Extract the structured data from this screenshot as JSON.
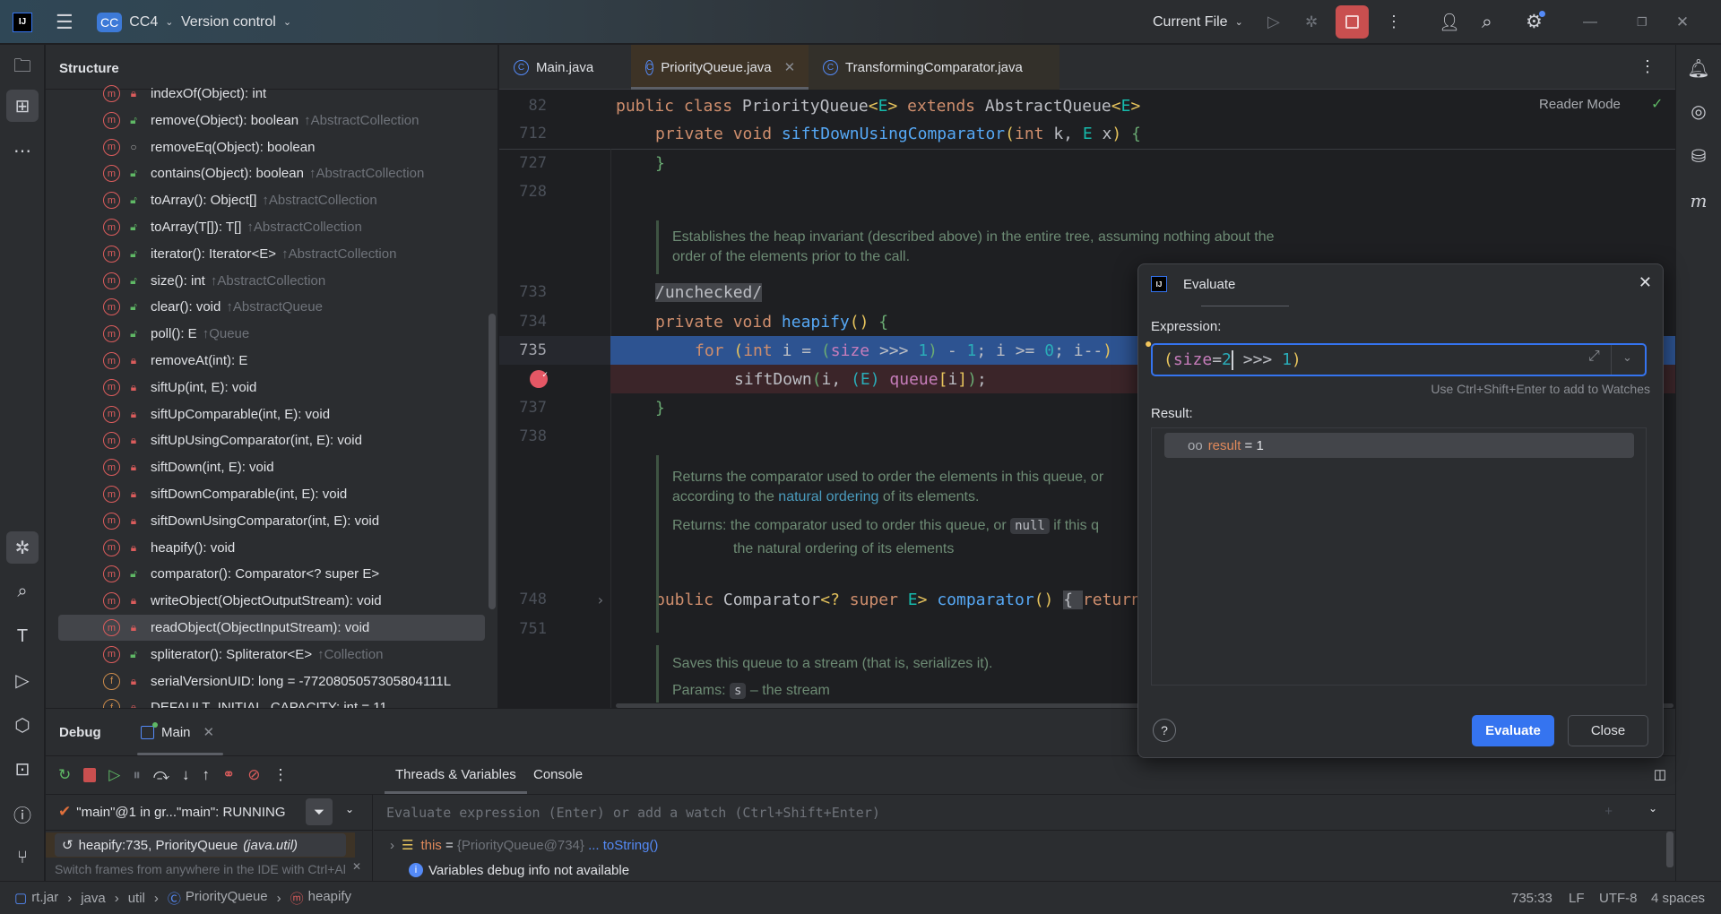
{
  "titlebar": {
    "project_badge": "CC",
    "project": "CC4",
    "vcs": "Version control",
    "run_config": "Current File"
  },
  "structure": {
    "title": "Structure",
    "items": [
      {
        "icon": "m",
        "vis": "priv",
        "label": "indexOf(Object): int",
        "inherited": ""
      },
      {
        "icon": "m",
        "vis": "pub",
        "label": "remove(Object): boolean",
        "inherited": "↑AbstractCollection"
      },
      {
        "icon": "m",
        "vis": "pkg",
        "label": "removeEq(Object): boolean",
        "inherited": ""
      },
      {
        "icon": "m",
        "vis": "pub",
        "label": "contains(Object): boolean",
        "inherited": "↑AbstractCollection"
      },
      {
        "icon": "m",
        "vis": "pub",
        "label": "toArray(): Object[]",
        "inherited": "↑AbstractCollection"
      },
      {
        "icon": "m",
        "vis": "pub",
        "label": "toArray(T[]): T[]",
        "inherited": "↑AbstractCollection"
      },
      {
        "icon": "m",
        "vis": "pub",
        "label": "iterator(): Iterator<E>",
        "inherited": "↑AbstractCollection"
      },
      {
        "icon": "m",
        "vis": "pub",
        "label": "size(): int",
        "inherited": "↑AbstractCollection"
      },
      {
        "icon": "m",
        "vis": "pub",
        "label": "clear(): void",
        "inherited": "↑AbstractQueue"
      },
      {
        "icon": "m",
        "vis": "pub",
        "label": "poll(): E",
        "inherited": "↑Queue"
      },
      {
        "icon": "m",
        "vis": "priv",
        "label": "removeAt(int): E",
        "inherited": ""
      },
      {
        "icon": "m",
        "vis": "priv",
        "label": "siftUp(int, E): void",
        "inherited": ""
      },
      {
        "icon": "m",
        "vis": "priv",
        "label": "siftUpComparable(int, E): void",
        "inherited": ""
      },
      {
        "icon": "m",
        "vis": "priv",
        "label": "siftUpUsingComparator(int, E): void",
        "inherited": ""
      },
      {
        "icon": "m",
        "vis": "priv",
        "label": "siftDown(int, E): void",
        "inherited": ""
      },
      {
        "icon": "m",
        "vis": "priv",
        "label": "siftDownComparable(int, E): void",
        "inherited": ""
      },
      {
        "icon": "m",
        "vis": "priv",
        "label": "siftDownUsingComparator(int, E): void",
        "inherited": ""
      },
      {
        "icon": "m",
        "vis": "priv",
        "label": "heapify(): void",
        "inherited": ""
      },
      {
        "icon": "m",
        "vis": "pub",
        "label": "comparator(): Comparator<? super E>",
        "inherited": ""
      },
      {
        "icon": "m",
        "vis": "priv",
        "label": "writeObject(ObjectOutputStream): void",
        "inherited": ""
      },
      {
        "icon": "m",
        "vis": "priv",
        "label": "readObject(ObjectInputStream): void",
        "inherited": "",
        "selected": true
      },
      {
        "icon": "m",
        "vis": "pub",
        "label": "spliterator(): Spliterator<E>",
        "inherited": "↑Collection"
      },
      {
        "icon": "f",
        "vis": "priv",
        "label": "serialVersionUID: long = -7720805057305804111L",
        "inherited": ""
      },
      {
        "icon": "f",
        "vis": "priv",
        "label": "DEFAULT_INITIAL_CAPACITY: int = 11",
        "inherited": ""
      }
    ]
  },
  "editor": {
    "tabs": [
      {
        "label": "Main.java"
      },
      {
        "label": "PriorityQueue.java",
        "active": true
      },
      {
        "label": "TransformingComparator.java"
      }
    ],
    "reader_mode": "Reader Mode",
    "lines": [
      {
        "n": "82",
        "indent": 0,
        "tokens": [
          [
            "public class ",
            "kw"
          ],
          [
            "PriorityQueue",
            "pl"
          ],
          [
            "<",
            "br"
          ],
          [
            "E",
            "tp"
          ],
          [
            "> ",
            "br"
          ],
          [
            "extends ",
            "kw"
          ],
          [
            "AbstractQueue",
            "pl"
          ],
          [
            "<",
            "br"
          ],
          [
            "E",
            "tp"
          ],
          [
            ">",
            "br"
          ]
        ]
      },
      {
        "n": "712",
        "indent": 1,
        "tokens": [
          [
            "private void ",
            "kw"
          ],
          [
            "siftDownUsingComparator",
            "fn"
          ],
          [
            "(",
            "br"
          ],
          [
            "int ",
            "kw"
          ],
          [
            "k, ",
            "pl"
          ],
          [
            "E ",
            "tp"
          ],
          [
            "x",
            "pl"
          ],
          [
            ") ",
            "br"
          ],
          [
            "{",
            "gb"
          ]
        ]
      },
      {
        "n": "727",
        "indent": 1,
        "tokens": [
          [
            "}",
            "gb"
          ]
        ]
      },
      {
        "n": "728",
        "indent": 0,
        "tokens": []
      },
      {
        "n": "733",
        "indent": 1,
        "tokens": [
          [
            "/unchecked/",
            "hl"
          ]
        ]
      },
      {
        "n": "734",
        "indent": 1,
        "tokens": [
          [
            "private void ",
            "kw"
          ],
          [
            "heapify",
            "fn"
          ],
          [
            "() ",
            "br"
          ],
          [
            "{",
            "gb"
          ]
        ]
      },
      {
        "n": "735",
        "indent": 2,
        "current": true,
        "tokens": [
          [
            "for ",
            "kw"
          ],
          [
            "(",
            "br"
          ],
          [
            "int ",
            "kw"
          ],
          [
            "i = ",
            "pl"
          ],
          [
            "(",
            "gb"
          ],
          [
            "size",
            "fld"
          ],
          [
            " >>> ",
            "pl"
          ],
          [
            "1",
            "num"
          ],
          [
            ")",
            "gb"
          ],
          [
            " - ",
            "pl"
          ],
          [
            "1",
            "num"
          ],
          [
            "; i >= ",
            "pl"
          ],
          [
            "0",
            "num"
          ],
          [
            "; i--",
            "pl"
          ],
          [
            ")",
            "br"
          ]
        ]
      },
      {
        "n": "",
        "indent": 3,
        "breakpoint": true,
        "tokens": [
          [
            "siftDown",
            "pl"
          ],
          [
            "(",
            "gb"
          ],
          [
            "i, ",
            "pl"
          ],
          [
            "(E) ",
            "num"
          ],
          [
            "queue",
            "fld"
          ],
          [
            "[",
            "br"
          ],
          [
            "i",
            "pl"
          ],
          [
            "]",
            "br"
          ],
          [
            ")",
            "gb"
          ],
          [
            ";",
            "pl"
          ]
        ]
      },
      {
        "n": "737",
        "indent": 1,
        "tokens": [
          [
            "}",
            "gb"
          ]
        ]
      },
      {
        "n": "738",
        "indent": 0,
        "tokens": []
      },
      {
        "n": "748",
        "indent": 1,
        "fold": true,
        "tokens": [
          [
            "public ",
            "kw"
          ],
          [
            "Comparator",
            "pl"
          ],
          [
            "<? ",
            "br"
          ],
          [
            "super ",
            "kw"
          ],
          [
            "E",
            "tp"
          ],
          [
            "> ",
            "br"
          ],
          [
            "comparator",
            "fn"
          ],
          [
            "() ",
            "br"
          ],
          [
            "{ ",
            "hl"
          ],
          [
            "return",
            "kw"
          ]
        ]
      },
      {
        "n": "751",
        "indent": 0,
        "tokens": []
      }
    ],
    "docs": {
      "heapify": [
        "Establishes the heap invariant (described above) in the entire tree, assuming nothing about the",
        "order of the elements prior to the call."
      ],
      "comparator_1a": "Returns the comparator used to order the elements in this queue, or",
      "comparator_1b_pre": "according to the ",
      "comparator_1b_link": "natural ordering",
      "comparator_1b_post": " of its elements.",
      "returns_label": "Returns:",
      "returns_pre": "the comparator used to order this queue, or ",
      "returns_chip": "null",
      "returns_post": " if this q",
      "returns_2": "the natural ordering of its elements",
      "write_1": "Saves this queue to a stream (that is, serializes it).",
      "params_label": "Params:",
      "params_chip": "s",
      "params_post": "– the stream"
    }
  },
  "evaluate": {
    "title": "Evaluate",
    "expression_label": "Expression:",
    "expression": [
      [
        "(",
        "br"
      ],
      [
        "size",
        "fld"
      ],
      [
        "=",
        "pl"
      ],
      [
        "2",
        "num"
      ],
      [
        " >>> ",
        "pl"
      ],
      [
        "1",
        "num"
      ],
      [
        ")",
        "br"
      ]
    ],
    "hint": "Use Ctrl+Shift+Enter to add to Watches",
    "result_label": "Result:",
    "result_name": "result",
    "result_eq": " = ",
    "result_value": "1",
    "evaluate_btn": "Evaluate",
    "close_btn": "Close",
    "accent": "#3574f0"
  },
  "debug": {
    "title": "Debug",
    "session_tab": "Main",
    "tabs": [
      "Threads & Variables",
      "Console"
    ],
    "thread": "\"main\"@1 in gr...\"main\": RUNNING",
    "frame": "heapify:735, PriorityQueue",
    "frame_pkg": "(java.util)",
    "hint": "Switch frames from anywhere in the IDE with Ctrl+Al",
    "watch_placeholder": "Evaluate expression (Enter) or add a watch (Ctrl+Shift+Enter)",
    "var_name": "this",
    "var_eq": " = ",
    "var_value": "{PriorityQueue@734}",
    "var_link": "... toString()",
    "info": "Variables debug info not available"
  },
  "statusbar": {
    "crumbs": [
      "rt.jar",
      "java",
      "util",
      "PriorityQueue",
      "heapify"
    ],
    "position": "735:33",
    "line_sep": "LF",
    "encoding": "UTF-8",
    "indent": "4 spaces"
  }
}
